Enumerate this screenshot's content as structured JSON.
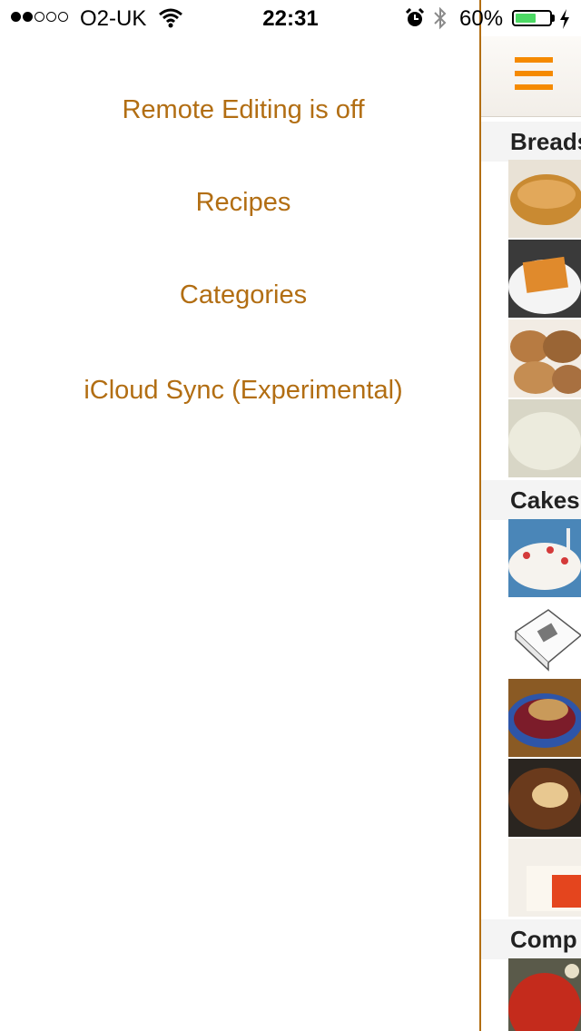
{
  "status_bar": {
    "carrier": "O2-UK",
    "time": "22:31",
    "battery_percent": "60%",
    "battery_level": 0.6,
    "signal_bars": 2,
    "icons": [
      "wifi-icon",
      "alarm-icon",
      "bluetooth-icon",
      "charging-icon"
    ]
  },
  "menu": {
    "items": [
      {
        "label": "Remote Editing is off"
      },
      {
        "label": "Recipes"
      },
      {
        "label": "Categories"
      },
      {
        "label": "iCloud Sync (Experimental)"
      }
    ]
  },
  "content": {
    "sections": [
      {
        "header": "Breads",
        "thumbnails": [
          "bread-loaf",
          "pastry-slice",
          "bread-rolls",
          "dough"
        ]
      },
      {
        "header": "Cakes",
        "thumbnails": [
          "decorated-cake",
          "recipe-book",
          "berry-crumble",
          "baked-tart",
          "sponge-cake"
        ]
      },
      {
        "header": "Comp",
        "thumbnails": [
          "tomato-sauce"
        ]
      }
    ]
  },
  "colors": {
    "accent": "#b26e13",
    "hamburger": "#f58a00",
    "battery_fill": "#4cd964",
    "section_bg": "#f4f4f4"
  }
}
